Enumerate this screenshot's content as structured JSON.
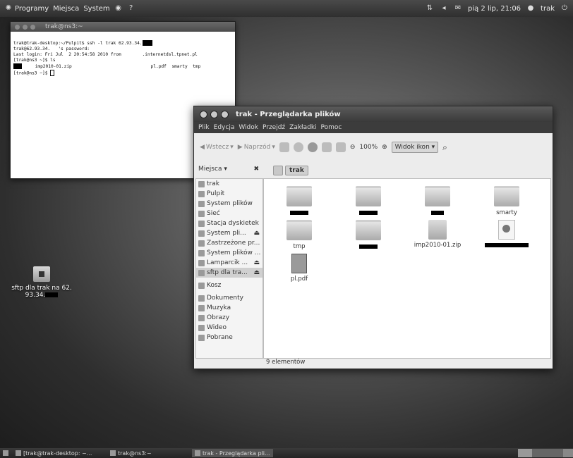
{
  "top_panel": {
    "menus": [
      "Programy",
      "Miejsca",
      "System"
    ],
    "clock": "pią 2 lip, 21:06",
    "user": "trak"
  },
  "terminal": {
    "title": "trak@ns3:~",
    "lines": [
      "trak@trak-desktop:~/Pulpit$ ssh -l trak 62.93.34.",
      "trak@62.93.34.   's password:",
      "Last login: Fri Jul  2 20:54:58 2010 from        .internetdsl.tpnet.pl",
      "[trak@ns3 ~]$ ls",
      "     imp2010-01.zip                              pl.pdf  smarty  tmp",
      "[trak@ns3 ~]$ "
    ]
  },
  "desktop_icon": {
    "label_line1": "sftp dla trak na 62.",
    "label_line2": "93.34."
  },
  "file_manager": {
    "title": "trak - Przeglądarka plików",
    "menu": [
      "Plik",
      "Edycja",
      "Widok",
      "Przejdź",
      "Zakładki",
      "Pomoc"
    ],
    "toolbar": {
      "back": "Wstecz",
      "forward": "Naprzód",
      "zoom": "100%",
      "view_mode": "Widok ikon"
    },
    "sidebar_title": "Miejsca",
    "breadcrumb": "trak",
    "sidebar": [
      {
        "label": "trak",
        "eject": false
      },
      {
        "label": "Pulpit",
        "eject": false
      },
      {
        "label": "System plików",
        "eject": false
      },
      {
        "label": "Sieć",
        "eject": false
      },
      {
        "label": "Stacja dyskietek",
        "eject": false
      },
      {
        "label": "System pli...",
        "eject": true
      },
      {
        "label": "Zastrzeżone pr...",
        "eject": false
      },
      {
        "label": "System plików ...",
        "eject": false
      },
      {
        "label": "Lamparcik ...",
        "eject": true
      },
      {
        "label": "sftp dla tra...",
        "eject": true,
        "selected": true
      },
      {
        "label": "Kosz",
        "eject": false
      },
      {
        "label": "Dokumenty",
        "eject": false
      },
      {
        "label": "Muzyka",
        "eject": false
      },
      {
        "label": "Obrazy",
        "eject": false
      },
      {
        "label": "Wideo",
        "eject": false
      },
      {
        "label": "Pobrane",
        "eject": false
      }
    ],
    "files": [
      {
        "label": "",
        "type": "folder"
      },
      {
        "label": "",
        "type": "folder"
      },
      {
        "label": "",
        "type": "folder"
      },
      {
        "label": "smarty",
        "type": "folder"
      },
      {
        "label": "tmp",
        "type": "folder"
      },
      {
        "label": "",
        "type": "folder"
      },
      {
        "label": "imp2010-01.zip",
        "type": "zip"
      },
      {
        "label": "",
        "type": "html"
      },
      {
        "label": "pl.pdf",
        "type": "pdf"
      }
    ],
    "status": "9 elementów"
  },
  "taskbar": {
    "items": [
      "[trak@trak-desktop: ~...",
      "trak@ns3:~",
      "trak - Przeglądarka pli..."
    ]
  }
}
